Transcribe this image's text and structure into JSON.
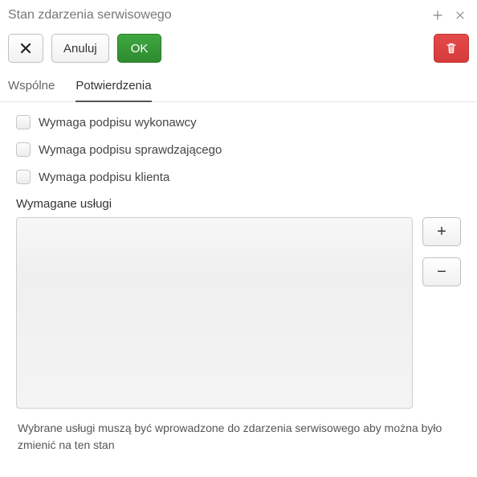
{
  "titlebar": {
    "title": "Stan zdarzenia serwisowego"
  },
  "toolbar": {
    "cancel_label": "Anuluj",
    "ok_label": "OK"
  },
  "tabs": [
    {
      "label": "Wspólne",
      "active": false
    },
    {
      "label": "Potwierdzenia",
      "active": true
    }
  ],
  "checkboxes": [
    {
      "label": "Wymaga podpisu wykonawcy"
    },
    {
      "label": "Wymaga podpisu sprawdzającego"
    },
    {
      "label": "Wymaga podpisu klienta"
    }
  ],
  "required_services": {
    "label": "Wymagane usługi",
    "help": "Wybrane usługi muszą być wprowadzone do zdarzenia serwisowego aby można było zmienić na ten stan"
  },
  "icons": {
    "plus": "+",
    "minus": "−"
  }
}
